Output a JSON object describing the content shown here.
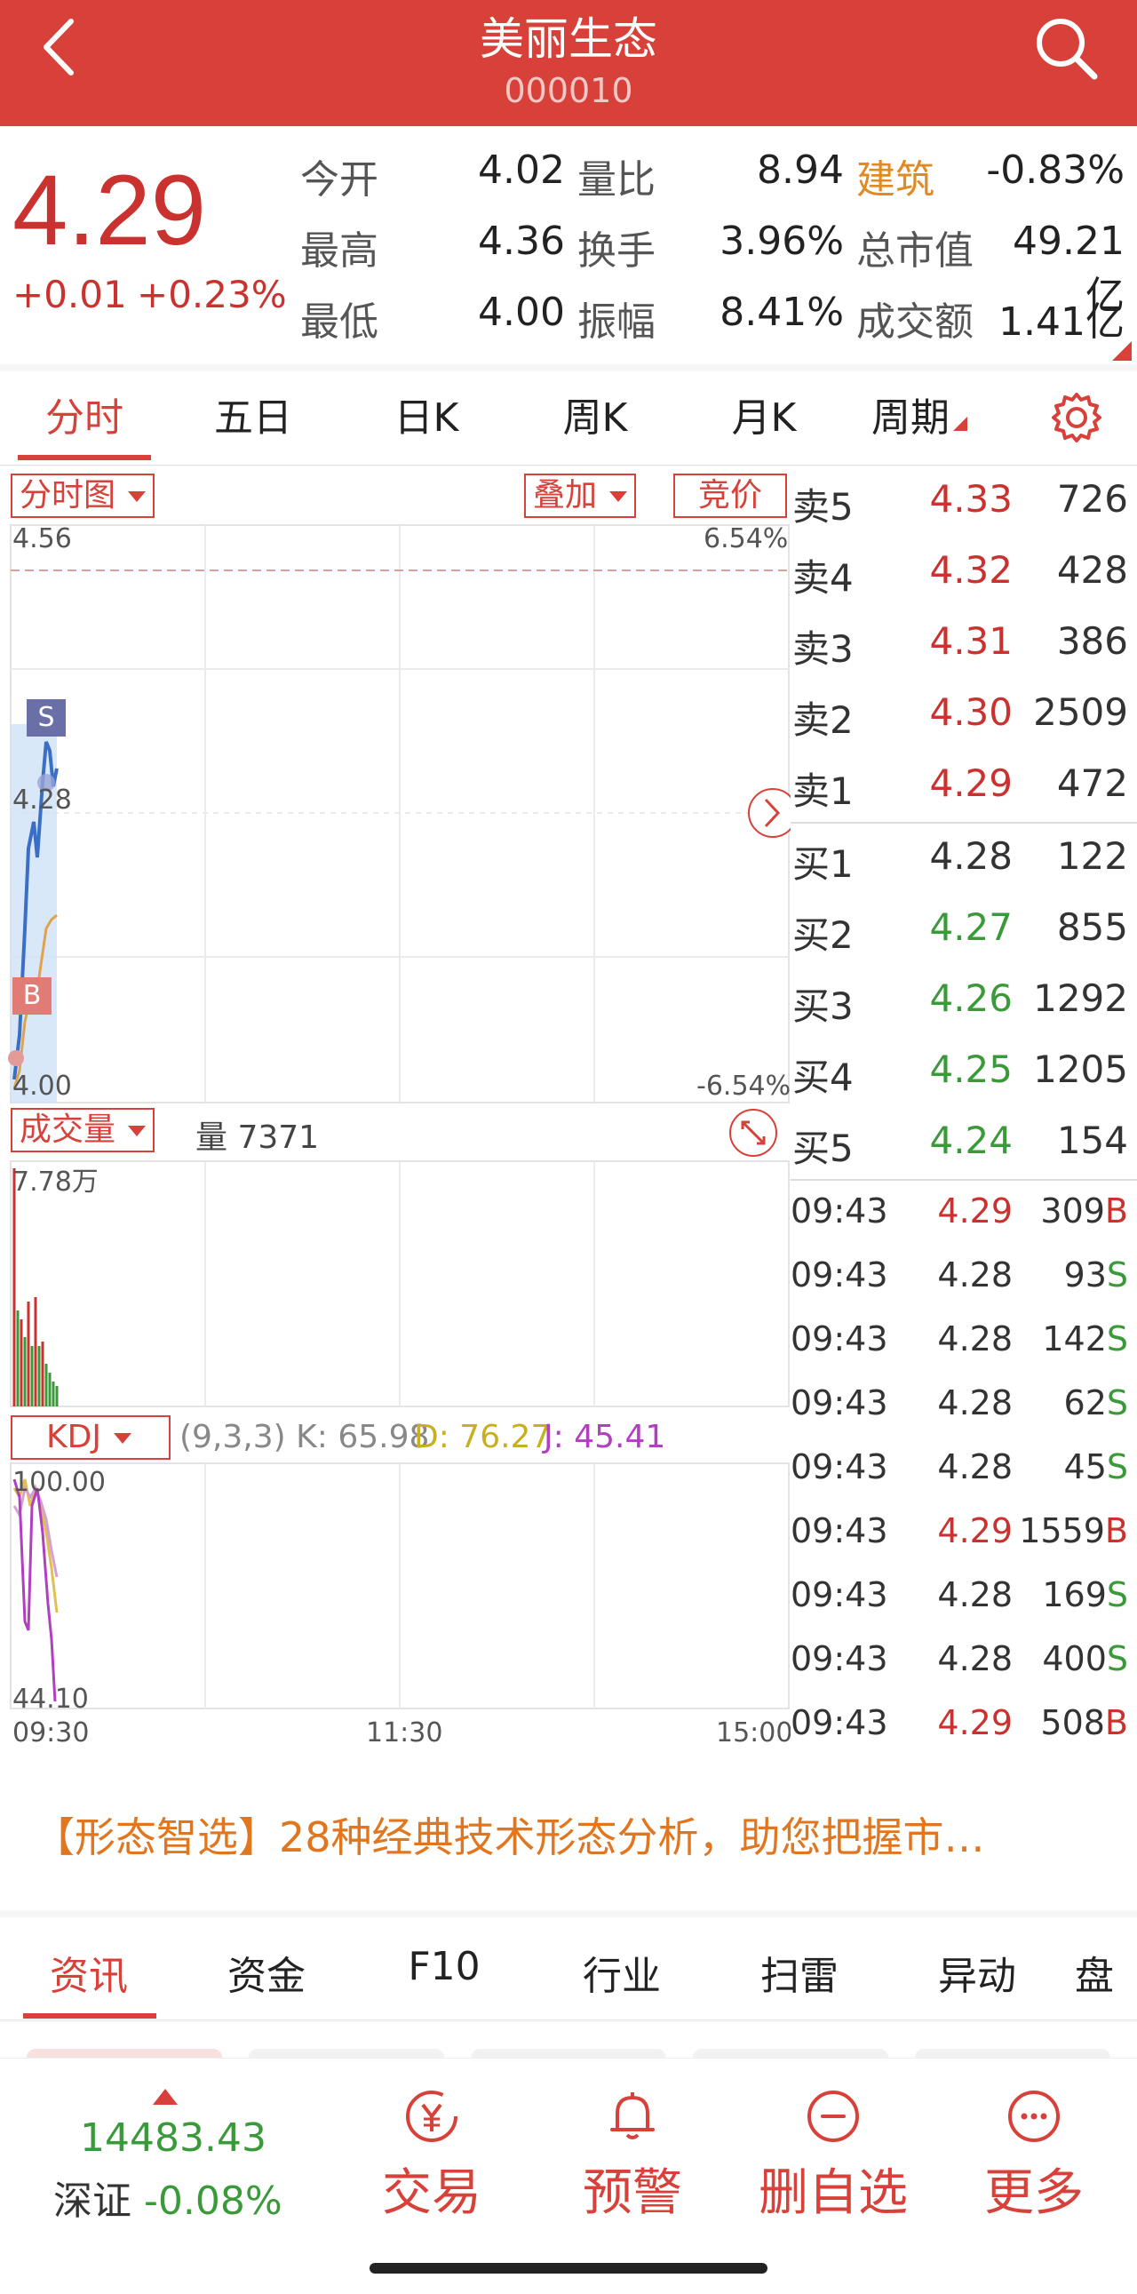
{
  "header": {
    "title": "美丽生态",
    "code": "000010",
    "back_icon": "chevron-left-icon",
    "search_icon": "search-icon"
  },
  "quote": {
    "price": "4.29",
    "change": "+0.01",
    "change_pct": "+0.23%",
    "stats": [
      {
        "label": "今开",
        "value": "4.02"
      },
      {
        "label": "最高",
        "value": "4.36"
      },
      {
        "label": "最低",
        "value": "4.00"
      },
      {
        "label": "量比",
        "value": "8.94"
      },
      {
        "label": "换手",
        "value": "3.96%"
      },
      {
        "label": "振幅",
        "value": "8.41%"
      },
      {
        "label": "建筑",
        "value": "-0.83%"
      },
      {
        "label": "总市值",
        "value": "49.21亿"
      },
      {
        "label": "成交额",
        "value": "1.41亿"
      }
    ]
  },
  "tabs": [
    {
      "label": "分时"
    },
    {
      "label": "五日"
    },
    {
      "label": "日K"
    },
    {
      "label": "周K"
    },
    {
      "label": "月K"
    },
    {
      "label": "周期"
    }
  ],
  "chart": {
    "mode_button": "分时图",
    "overlay_button": "叠加",
    "auction_button": "竞价",
    "price_top": "4.56",
    "pct_top": "6.54%",
    "price_mid": "4.28",
    "price_bottom": "4.00",
    "pct_bottom": "-6.54%",
    "volume_button": "成交量",
    "volume_text": "量 7371",
    "volume_max": "7.78万",
    "kdj_button": "KDJ",
    "kdj_params": "(9,3,3) K: 65.98",
    "kdj_d": "D: 76.27",
    "kdj_j": "J: 45.41",
    "kdj_top": "100.00",
    "kdj_bottom": "44.10",
    "time_start": "09:30",
    "time_mid": "11:30",
    "time_end": "15:00",
    "sell_marker": "S",
    "buy_marker": "B",
    "colors": {
      "price_line": "#3a6fc4",
      "avg_line": "#e0a24a",
      "k_line": "#e0c050",
      "d_line": "#d8a0d0",
      "j_line": "#b040c0"
    }
  },
  "orderbook": {
    "asks": [
      {
        "label": "卖5",
        "price": "4.33",
        "vol": "726"
      },
      {
        "label": "卖4",
        "price": "4.32",
        "vol": "428"
      },
      {
        "label": "卖3",
        "price": "4.31",
        "vol": "386"
      },
      {
        "label": "卖2",
        "price": "4.30",
        "vol": "2509"
      },
      {
        "label": "卖1",
        "price": "4.29",
        "vol": "472"
      }
    ],
    "bids": [
      {
        "label": "买1",
        "price": "4.28",
        "vol": "122"
      },
      {
        "label": "买2",
        "price": "4.27",
        "vol": "855"
      },
      {
        "label": "买3",
        "price": "4.26",
        "vol": "1292"
      },
      {
        "label": "买4",
        "price": "4.25",
        "vol": "1205"
      },
      {
        "label": "买5",
        "price": "4.24",
        "vol": "154"
      }
    ],
    "trades": [
      {
        "time": "09:43",
        "price": "4.29",
        "vol": "309",
        "flag": "B"
      },
      {
        "time": "09:43",
        "price": "4.28",
        "vol": "93",
        "flag": "S"
      },
      {
        "time": "09:43",
        "price": "4.28",
        "vol": "142",
        "flag": "S"
      },
      {
        "time": "09:43",
        "price": "4.28",
        "vol": "62",
        "flag": "S"
      },
      {
        "time": "09:43",
        "price": "4.28",
        "vol": "45",
        "flag": "S"
      },
      {
        "time": "09:43",
        "price": "4.29",
        "vol": "1559",
        "flag": "B"
      },
      {
        "time": "09:43",
        "price": "4.28",
        "vol": "169",
        "flag": "S"
      },
      {
        "time": "09:43",
        "price": "4.28",
        "vol": "400",
        "flag": "S"
      },
      {
        "time": "09:43",
        "price": "4.29",
        "vol": "508",
        "flag": "B"
      }
    ]
  },
  "promo": {
    "text": "【形态智选】28种经典技术形态分析，助您把握市…"
  },
  "news_tabs": [
    {
      "label": "资讯"
    },
    {
      "label": "资金"
    },
    {
      "label": "F10"
    },
    {
      "label": "行业"
    },
    {
      "label": "扫雷"
    },
    {
      "label": "异动"
    },
    {
      "label": "盘"
    }
  ],
  "bottom": {
    "index_value": "14483.43",
    "index_name": "深证",
    "index_pct": "-0.08%",
    "actions": [
      {
        "label": "交易",
        "icon": "yen-icon"
      },
      {
        "label": "预警",
        "icon": "bell-icon"
      },
      {
        "label": "删自选",
        "icon": "minus-circle-icon"
      },
      {
        "label": "更多",
        "icon": "more-icon"
      }
    ]
  }
}
